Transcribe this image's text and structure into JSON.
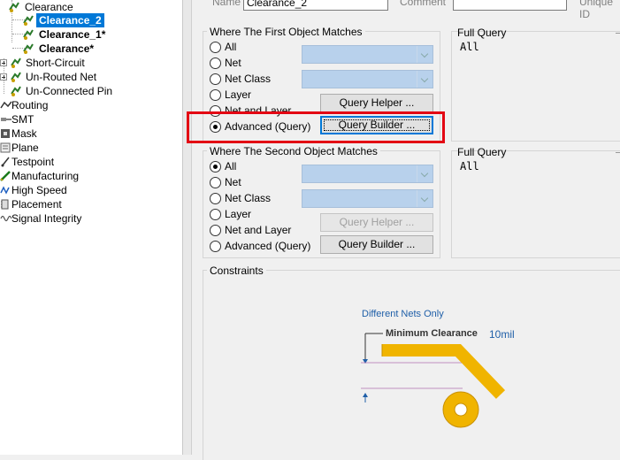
{
  "tree": {
    "items": [
      {
        "label": "Clearance",
        "style": "normal"
      },
      {
        "label": "Clearance_2",
        "style": "selected"
      },
      {
        "label": "Clearance_1*",
        "style": "bold"
      },
      {
        "label": "Clearance*",
        "style": "bold"
      },
      {
        "label": "Short-Circuit",
        "style": "normal"
      },
      {
        "label": "Un-Routed Net",
        "style": "normal"
      },
      {
        "label": "Un-Connected Pin",
        "style": "normal"
      },
      {
        "label": "Routing",
        "style": "normal"
      },
      {
        "label": "SMT",
        "style": "normal"
      },
      {
        "label": "Mask",
        "style": "normal"
      },
      {
        "label": "Plane",
        "style": "normal"
      },
      {
        "label": "Testpoint",
        "style": "normal"
      },
      {
        "label": "Manufacturing",
        "style": "normal"
      },
      {
        "label": "High Speed",
        "style": "normal"
      },
      {
        "label": "Placement",
        "style": "normal"
      },
      {
        "label": "Signal Integrity",
        "style": "normal"
      }
    ]
  },
  "header": {
    "name_label": "Name",
    "name_value": "Clearance_2",
    "comment_label": "Comment",
    "unique_id_label": "Unique ID"
  },
  "first_match": {
    "title": "Where The First Object Matches",
    "options": [
      "All",
      "Net",
      "Net Class",
      "Layer",
      "Net and Layer",
      "Advanced (Query)"
    ],
    "selected": "Advanced (Query)",
    "query_helper_label": "Query Helper ...",
    "query_builder_label": "Query Builder ...",
    "full_query_label": "Full Query",
    "full_query_value": "All"
  },
  "second_match": {
    "title": "Where The Second Object Matches",
    "options": [
      "All",
      "Net",
      "Net Class",
      "Layer",
      "Net and Layer",
      "Advanced (Query)"
    ],
    "selected": "All",
    "query_helper_label": "Query Helper ...",
    "query_builder_label": "Query Builder ...",
    "full_query_label": "Full Query",
    "full_query_value": "All"
  },
  "constraints": {
    "title": "Constraints",
    "different_nets_label": "Different Nets Only",
    "min_clearance_label": "Minimum Clearance",
    "min_clearance_value": "10mil"
  },
  "colors": {
    "highlight_box": "#e30613",
    "selection": "#0078d7",
    "combo_fill": "#b8d1ec",
    "trace_gold": "#f0b400",
    "link_blue": "#1f5fa8"
  }
}
